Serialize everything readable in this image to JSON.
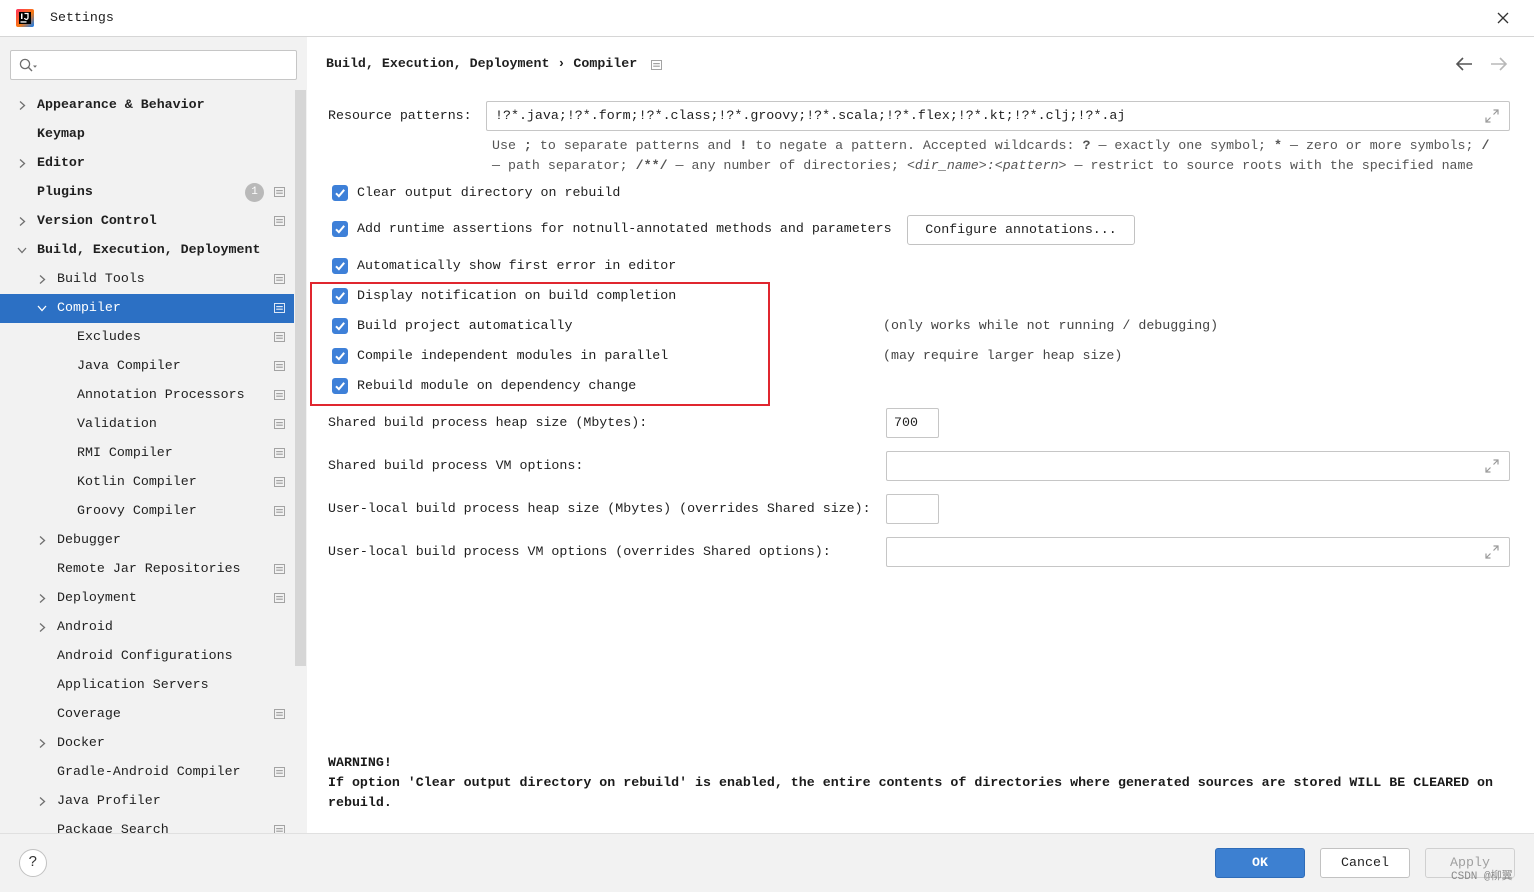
{
  "window": {
    "title": "Settings",
    "app_icon": "intellij-logo-icon",
    "close_icon": "close-icon"
  },
  "colors": {
    "accent": "#2c70c4",
    "checkbox": "#3e80d8",
    "highlight_border": "#e0262f",
    "primary_button": "#3d80d1",
    "sidebar_bg": "#f2f2f2"
  },
  "sidebar": {
    "search": {
      "value": "",
      "icon": "search-icon"
    },
    "items": [
      {
        "label": "Appearance & Behavior",
        "level": 0,
        "expandable": true,
        "expanded": false
      },
      {
        "label": "Keymap",
        "level": 0
      },
      {
        "label": "Editor",
        "level": 0,
        "expandable": true,
        "expanded": false
      },
      {
        "label": "Plugins",
        "level": 0,
        "badge": "1",
        "icon": "project-settings-icon"
      },
      {
        "label": "Version Control",
        "level": 0,
        "expandable": true,
        "expanded": false,
        "icon": "project-settings-icon"
      },
      {
        "label": "Build, Execution, Deployment",
        "level": 0,
        "expandable": true,
        "expanded": true
      },
      {
        "label": "Build Tools",
        "level": 1,
        "expandable": true,
        "expanded": false,
        "icon": "project-settings-icon"
      },
      {
        "label": "Compiler",
        "level": 1,
        "expandable": true,
        "expanded": true,
        "selected": true,
        "icon": "project-settings-icon"
      },
      {
        "label": "Excludes",
        "level": 2,
        "icon": "project-settings-icon"
      },
      {
        "label": "Java Compiler",
        "level": 2,
        "icon": "project-settings-icon"
      },
      {
        "label": "Annotation Processors",
        "level": 2,
        "icon": "project-settings-icon"
      },
      {
        "label": "Validation",
        "level": 2,
        "icon": "project-settings-icon"
      },
      {
        "label": "RMI Compiler",
        "level": 2,
        "icon": "project-settings-icon"
      },
      {
        "label": "Kotlin Compiler",
        "level": 2,
        "icon": "project-settings-icon"
      },
      {
        "label": "Groovy Compiler",
        "level": 2,
        "icon": "project-settings-icon"
      },
      {
        "label": "Debugger",
        "level": 1,
        "expandable": true,
        "expanded": false
      },
      {
        "label": "Remote Jar Repositories",
        "level": 1,
        "icon": "project-settings-icon"
      },
      {
        "label": "Deployment",
        "level": 1,
        "expandable": true,
        "expanded": false,
        "icon": "project-settings-icon"
      },
      {
        "label": "Android",
        "level": 1,
        "expandable": true,
        "expanded": false
      },
      {
        "label": "Android Configurations",
        "level": 1
      },
      {
        "label": "Application Servers",
        "level": 1
      },
      {
        "label": "Coverage",
        "level": 1,
        "icon": "project-settings-icon"
      },
      {
        "label": "Docker",
        "level": 1,
        "expandable": true,
        "expanded": false
      },
      {
        "label": "Gradle-Android Compiler",
        "level": 1,
        "icon": "project-settings-icon"
      },
      {
        "label": "Java Profiler",
        "level": 1,
        "expandable": true,
        "expanded": false
      },
      {
        "label": "Package Search",
        "level": 1,
        "icon": "project-settings-icon"
      }
    ]
  },
  "main": {
    "breadcrumb": {
      "parent": "Build, Execution, Deployment",
      "separator": "›",
      "current": "Compiler",
      "icon": "project-settings-icon"
    },
    "nav": {
      "back_icon": "back-arrow-icon",
      "forward_icon": "forward-arrow-icon"
    },
    "resource_patterns": {
      "label": "Resource patterns:",
      "value": "!?*.java;!?*.form;!?*.class;!?*.groovy;!?*.scala;!?*.flex;!?*.kt;!?*.clj;!?*.aj",
      "expand_icon": "expand-icon"
    },
    "help_lines": [
      [
        "Use ",
        ";",
        " to separate patterns and ",
        "!",
        " to negate a pattern. Accepted wildcards: ",
        "?",
        " — exactly one symbol; ",
        "*",
        " — zero or more symbols; ",
        "/"
      ],
      [
        "— path separator; ",
        "/**/",
        " — any number of directories; ",
        "<dir_name>:<pattern>",
        " — restrict to source roots with the specified name"
      ]
    ],
    "options": [
      {
        "label": "Clear output directory on rebuild",
        "checked": true
      },
      {
        "label": "Add runtime assertions for notnull-annotated methods and parameters",
        "checked": true,
        "button": "Configure annotations..."
      },
      {
        "label": "Automatically show first error in editor",
        "checked": true
      },
      {
        "label": "Display notification on build completion",
        "checked": true
      },
      {
        "label": "Build project automatically",
        "checked": true,
        "note": "(only works while not running / debugging)"
      },
      {
        "label": "Compile independent modules in parallel",
        "checked": true,
        "note": "(may require larger heap size)"
      },
      {
        "label": "Rebuild module on dependency change",
        "checked": true
      }
    ],
    "fields": [
      {
        "label": "Shared build process heap size (Mbytes):",
        "value": "700"
      },
      {
        "label": "Shared build process VM options:",
        "value": ""
      },
      {
        "label": "User-local build process heap size (Mbytes) (overrides Shared size):",
        "value": ""
      },
      {
        "label": "User-local build process VM options (overrides Shared options):",
        "value": ""
      }
    ],
    "warning": {
      "title": "WARNING!",
      "lines": [
        "If option 'Clear output directory on rebuild' is enabled, the entire contents of directories where generated sources are stored WILL BE CLEARED on",
        "rebuild."
      ]
    }
  },
  "footer": {
    "help_label": "?",
    "ok_label": "OK",
    "cancel_label": "Cancel",
    "apply_label": "Apply",
    "apply_enabled": false
  },
  "watermark": "CSDN @柳翼"
}
